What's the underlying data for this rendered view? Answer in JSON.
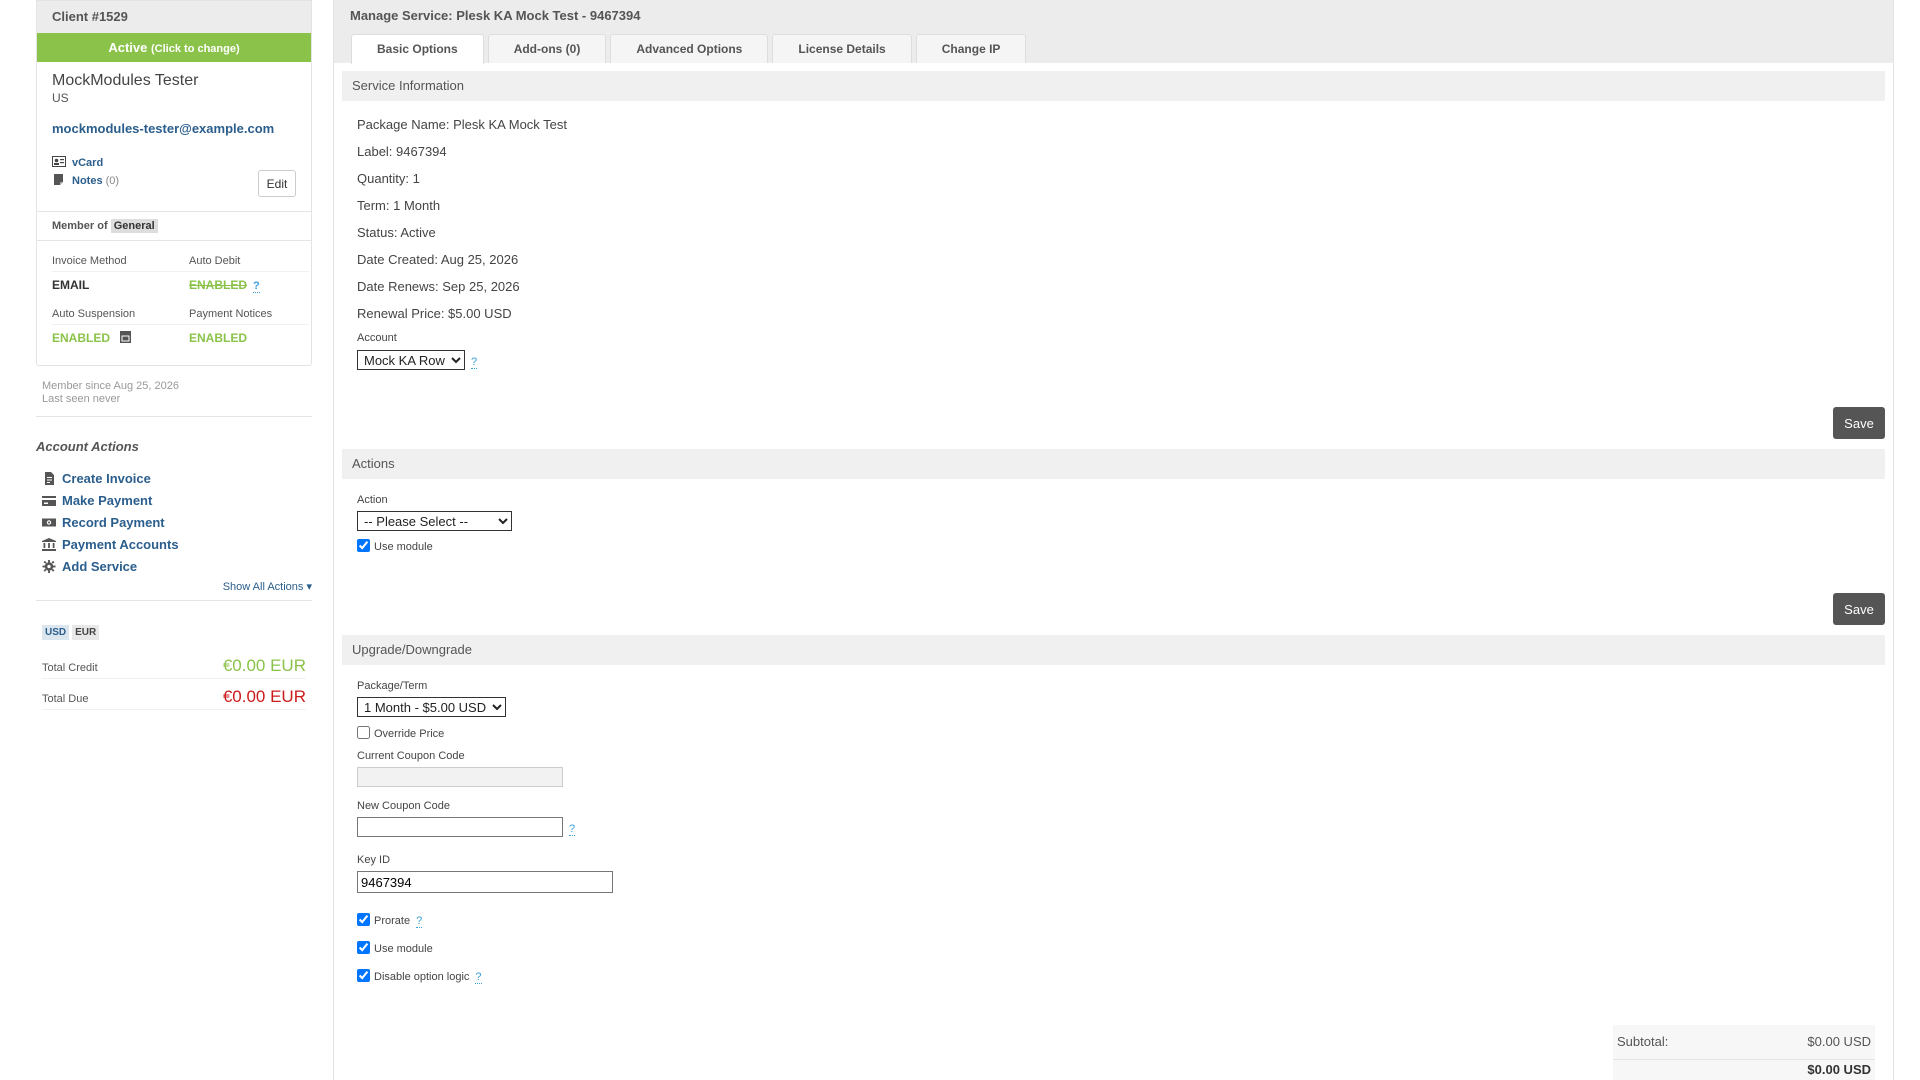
{
  "client": {
    "header": "Client #1529",
    "status": "Active",
    "status_hint": "(Click to change)",
    "name": "MockModules Tester",
    "country": "US",
    "email": "mockmodules-tester@example.com",
    "vcard_label": "vCard",
    "notes_label": "Notes",
    "notes_count": "(0)",
    "edit_label": "Edit",
    "member_of_label": "Member of",
    "group": "General",
    "invoice_method_label": "Invoice Method",
    "invoice_method_value": "EMAIL",
    "auto_debit_label": "Auto Debit",
    "auto_debit_value": "ENABLED",
    "auto_suspension_label": "Auto Suspension",
    "auto_suspension_value": "ENABLED",
    "payment_notices_label": "Payment Notices",
    "payment_notices_value": "ENABLED",
    "member_since": "Member since Aug 25, 2026",
    "last_seen": "Last seen never",
    "help_mark": "?"
  },
  "account_actions": {
    "title": "Account Actions",
    "items": [
      {
        "label": "Create Invoice",
        "icon": "file-invoice-icon"
      },
      {
        "label": "Make Payment",
        "icon": "credit-card-icon"
      },
      {
        "label": "Record Payment",
        "icon": "money-icon"
      },
      {
        "label": "Payment Accounts",
        "icon": "bank-icon"
      },
      {
        "label": "Add Service",
        "icon": "gear-icon"
      }
    ],
    "show_all": "Show All Actions ▾"
  },
  "currency": {
    "tabs": [
      "USD",
      "EUR"
    ],
    "total_credit_label": "Total Credit",
    "total_credit_value": "€0.00 EUR",
    "total_due_label": "Total Due",
    "total_due_value": "€0.00 EUR"
  },
  "service": {
    "title": "Manage Service: Plesk KA Mock Test - 9467394",
    "tabs": [
      "Basic Options",
      "Add-ons (0)",
      "Advanced Options",
      "License Details",
      "Change IP"
    ],
    "active_tab": "Basic Options",
    "info_header": "Service Information",
    "info_lines": [
      "Package Name: Plesk KA Mock Test",
      "Label: 9467394",
      "Quantity: 1",
      "Term: 1 Month",
      "Status: Active",
      "Date Created: Aug 25, 2026",
      "Date Renews: Sep 25, 2026",
      "Renewal Price: $5.00 USD"
    ],
    "account_label": "Account",
    "account_value": "Mock KA Row",
    "save_label": "Save",
    "actions_header": "Actions",
    "action_label": "Action",
    "action_value": "-- Please Select --",
    "use_module_label": "Use module",
    "upgrade_header": "Upgrade/Downgrade",
    "package_term_label": "Package/Term",
    "package_term_value": "1 Month - $5.00 USD",
    "override_price_label": "Override Price",
    "current_coupon_label": "Current Coupon Code",
    "new_coupon_label": "New Coupon Code",
    "key_id_label": "Key ID",
    "key_id_value": "9467394",
    "prorate_label": "Prorate",
    "disable_option_logic_label": "Disable option logic",
    "subtotal_label": "Subtotal:",
    "subtotal_value": "$0.00 USD",
    "total_value": "$0.00 USD"
  },
  "colors": {
    "active_green": "#8bc34a",
    "link_blue": "#2b5e8c",
    "due_red": "#cc1b1b",
    "save_button": "#555555"
  }
}
